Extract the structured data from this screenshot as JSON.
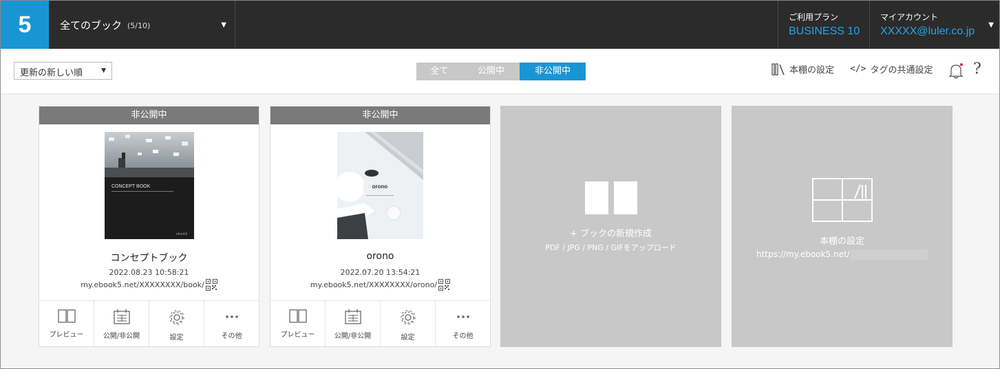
{
  "header": {
    "logo": "5",
    "book_selector": {
      "title": "全てのブック",
      "count": "(5/10)"
    },
    "plan": {
      "label": "ご利用プラン",
      "value": "BUSINESS 10"
    },
    "account": {
      "label": "マイアカウント",
      "value": "XXXXX@luler.co.jp"
    }
  },
  "toolbar": {
    "sort": {
      "selected": "更新の新しい順"
    },
    "filter_tabs": [
      {
        "label": "全て",
        "active": false
      },
      {
        "label": "公開中",
        "active": false
      },
      {
        "label": "非公開中",
        "active": true
      }
    ],
    "shelf_settings": "本棚の設定",
    "tag_settings": "タグの共通設定",
    "tag_code": "</>",
    "help": "?",
    "accent_color": "#1a95d4"
  },
  "books": [
    {
      "status": "非公開中",
      "title": "コンセプトブック",
      "updated": "2022.08.23 10:58:21",
      "url": "my.ebook5.net/XXXXXXXX/book/",
      "cover_text": "CONCEPT BOOK",
      "cover_brand": "ebook5"
    },
    {
      "status": "非公開中",
      "title": "orono",
      "updated": "2022.07.20 13:54:21",
      "url": "my.ebook5.net/XXXXXXXX/orono/",
      "cover_text": "orono",
      "cover_brand": ""
    }
  ],
  "book_actions": [
    "プレビュー",
    "公開/非公開",
    "設定",
    "その他"
  ],
  "new_book": {
    "label": "+ ブックの新規作成",
    "sub": "PDF / JPG / PNG / GIFをアップロード"
  },
  "shelf_card": {
    "label": "本棚の設定",
    "url": "https://my.ebook5.net/"
  }
}
